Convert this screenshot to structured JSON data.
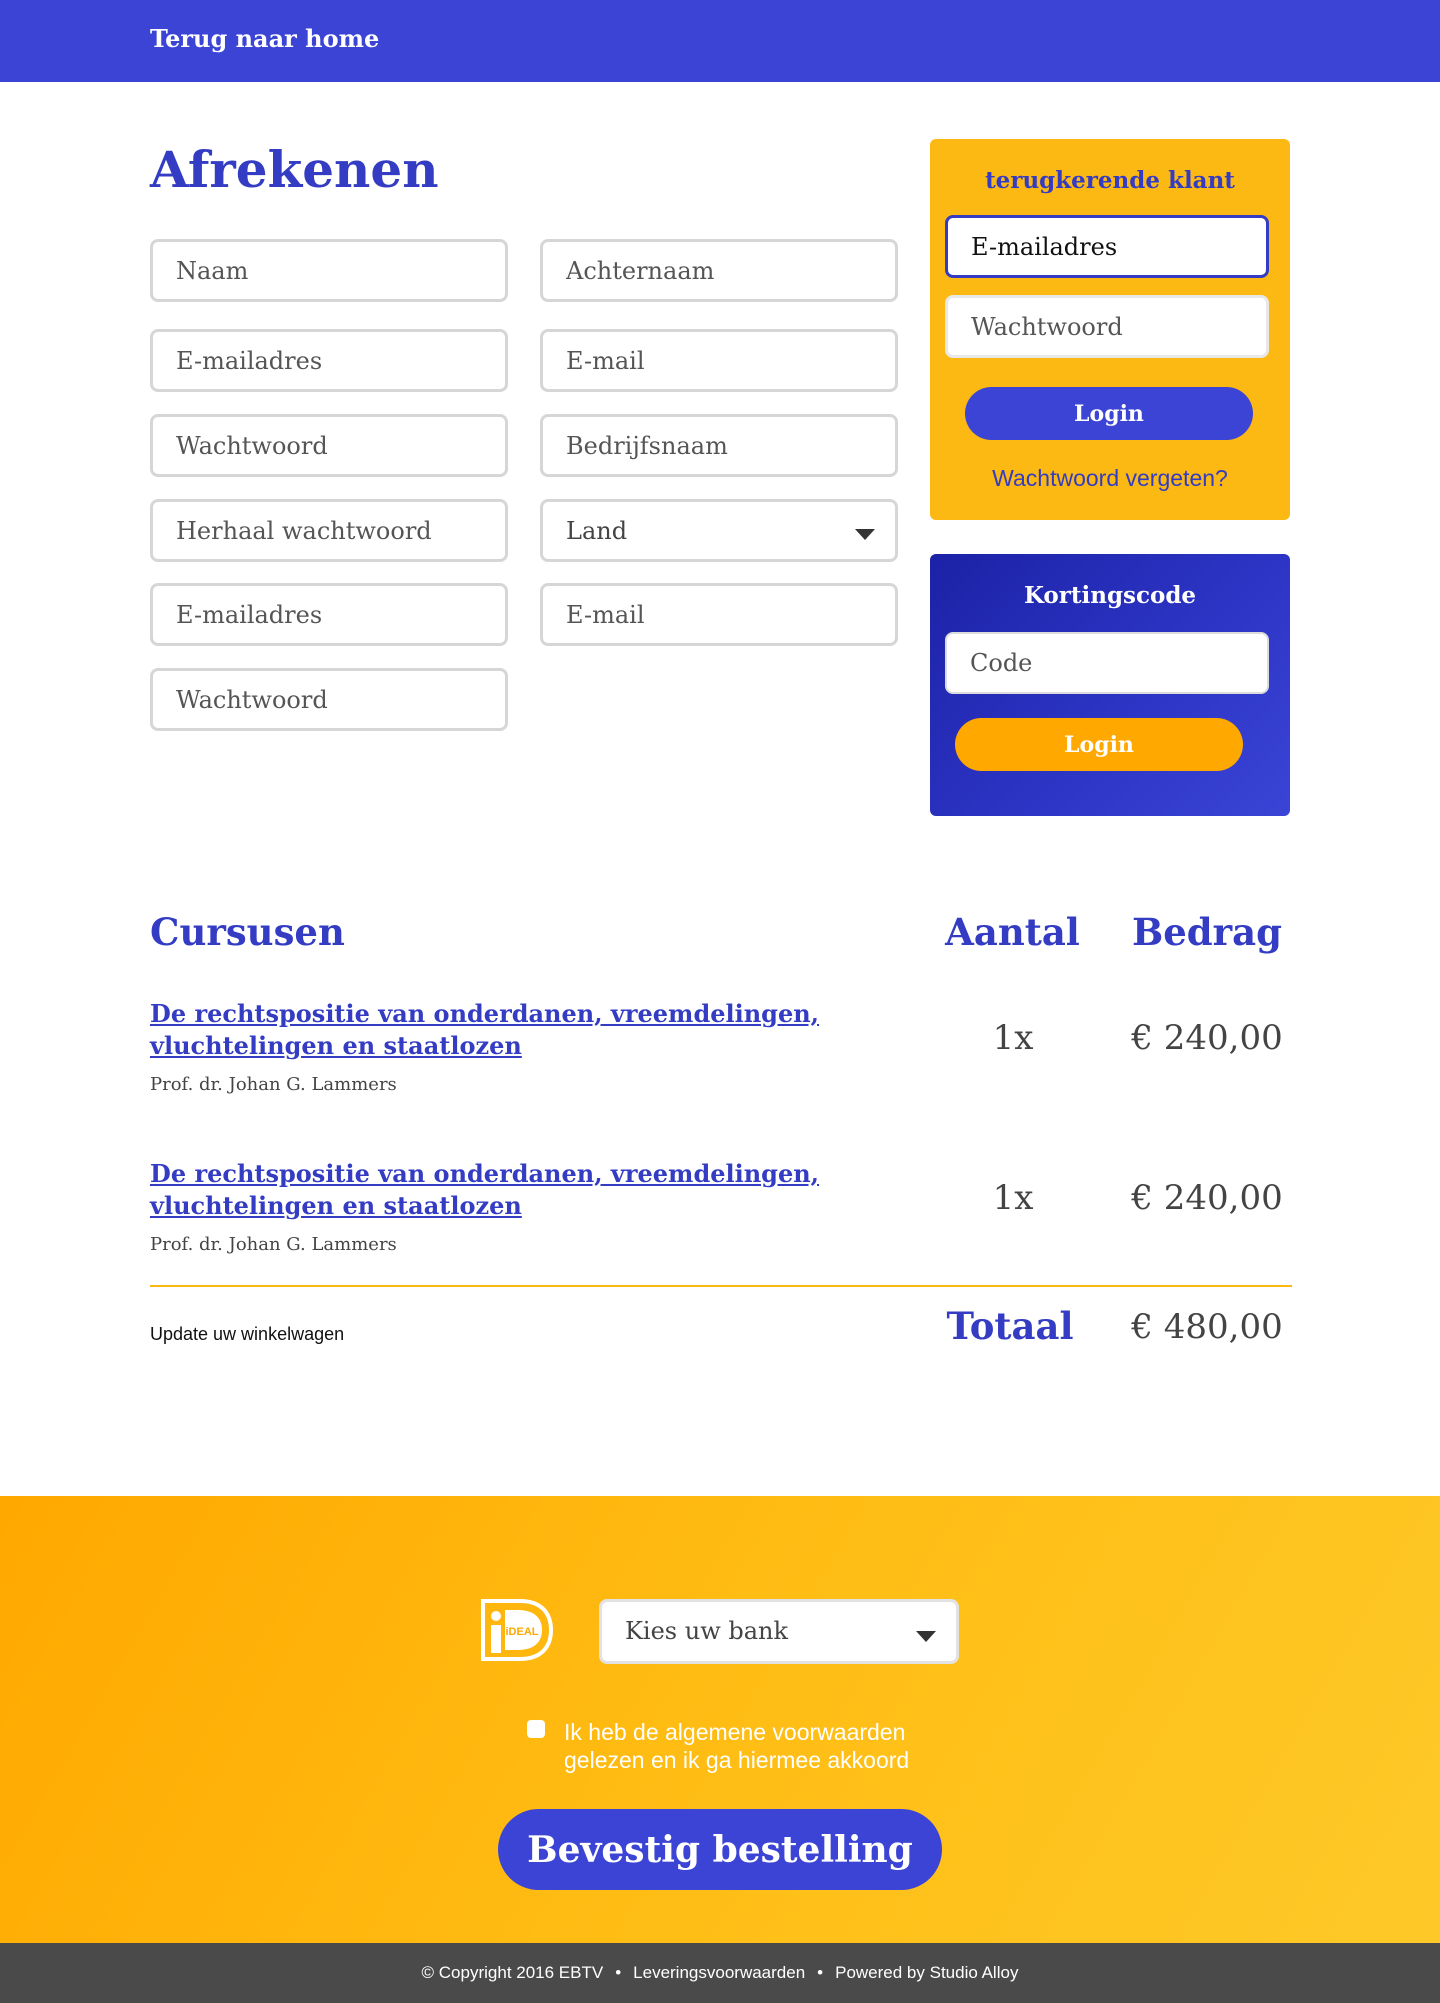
{
  "header": {
    "home_link": "Terug naar home"
  },
  "page_title": "Afrekenen",
  "form": {
    "naam": "Naam",
    "achternaam": "Achternaam",
    "emailadres_1": "E-mailadres",
    "email_1": "E-mail",
    "wachtwoord_1": "Wachtwoord",
    "bedrijfsnaam": "Bedrijfsnaam",
    "herhaal_wachtwoord": "Herhaal wachtwoord",
    "land": "Land",
    "emailadres_2": "E-mailadres",
    "email_2": "E-mail",
    "wachtwoord_2": "Wachtwoord"
  },
  "login_box": {
    "title": "terugkerende klant",
    "email_placeholder": "E-mailadres",
    "password_placeholder": "Wachtwoord",
    "login_label": "Login",
    "forgot_label": "Wachtwoord vergeten?"
  },
  "discount_box": {
    "title": "Kortingscode",
    "code_placeholder": "Code",
    "button_label": "Login"
  },
  "cart": {
    "col_courses": "Cursusen",
    "col_quantity": "Aantal",
    "col_amount": "Bedrag",
    "items": [
      {
        "title": "De rechtspositie van onderdanen, vreemdelingen, vluchtelingen en staatlozen",
        "author": "Prof. dr. Johan G. Lammers",
        "quantity": "1x",
        "amount": "€ 240,00"
      },
      {
        "title": "De rechtspositie van onderdanen, vreemdelingen, vluchtelingen en staatlozen",
        "author": "Prof. dr. Johan G. Lammers",
        "quantity": "1x",
        "amount": "€ 240,00"
      }
    ],
    "update_link": "Update uw winkelwagen",
    "total_label": "Totaal",
    "total_amount": "€ 480,00"
  },
  "payment": {
    "logo_text": "iDEAL",
    "bank_select": "Kies uw bank",
    "terms": "Ik heb de algemene voorwaarden gelezen en ik ga hiermee akkoord",
    "terms_checked": false,
    "confirm_label": "Bevestig bestelling"
  },
  "footer": {
    "copyright": "© Copyright  2016  EBTV",
    "separator": "•",
    "terms_link": "Leveringsvoorwaarden",
    "powered_by": "Powered by Studio Alloy"
  },
  "colors": {
    "primary_blue": "#3b44d4",
    "heading_blue": "#333cc2",
    "accent_yellow": "#fdb913",
    "accent_orange": "#ffa800",
    "footer_gray": "#4a4a4a"
  }
}
